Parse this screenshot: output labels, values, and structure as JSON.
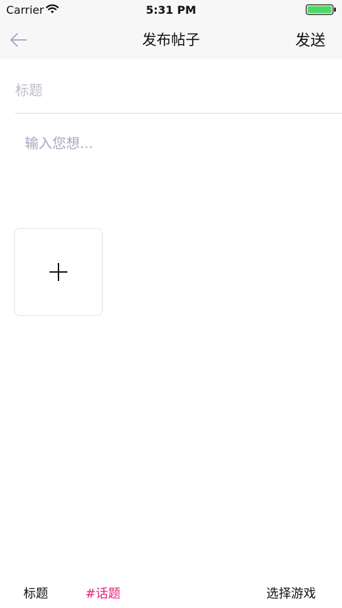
{
  "status_bar": {
    "carrier": "Carrier",
    "time": "5:31 PM",
    "battery_color": "#4cd964"
  },
  "nav": {
    "title": "发布帖子",
    "send_label": "发送",
    "back_icon": "arrow-left-icon",
    "back_icon_color": "#a3a0c2"
  },
  "post_form": {
    "title_placeholder": "标题",
    "title_value": "",
    "content_placeholder": "输入您想...",
    "content_value": "",
    "add_image_icon": "plus-icon"
  },
  "bottom_bar": {
    "title_label": "标题",
    "topic_label": "#话题",
    "topic_color": "#f01b7a",
    "game_label": "选择游戏"
  }
}
